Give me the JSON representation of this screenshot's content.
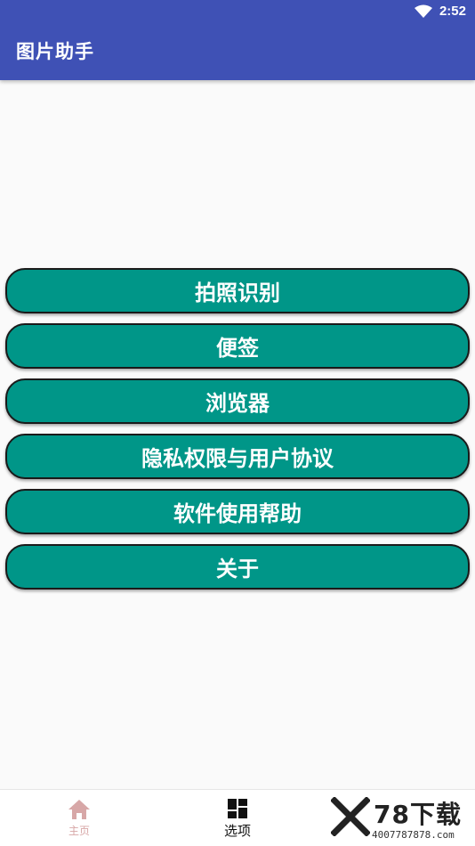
{
  "status_bar": {
    "time": "2:52",
    "wifi_icon": "wifi-icon"
  },
  "app_bar": {
    "title": "图片助手",
    "color": "#3f51b5"
  },
  "menu": {
    "accent_color": "#009688",
    "items": [
      {
        "label": "拍照识别"
      },
      {
        "label": "便签"
      },
      {
        "label": "浏览器"
      },
      {
        "label": "隐私权限与用户协议"
      },
      {
        "label": "软件使用帮助"
      },
      {
        "label": "关于"
      }
    ]
  },
  "bottom_nav": {
    "items": [
      {
        "label": "主页",
        "icon": "home-icon",
        "color": "#d7a7a7"
      },
      {
        "label": "选项",
        "icon": "grid-icon",
        "active": true,
        "color": "#111111"
      },
      {
        "label": "",
        "icon": "person-icon",
        "color": "#d7a7a7"
      }
    ]
  },
  "watermark": {
    "text": "78下载",
    "sub": "4007787878.com"
  }
}
